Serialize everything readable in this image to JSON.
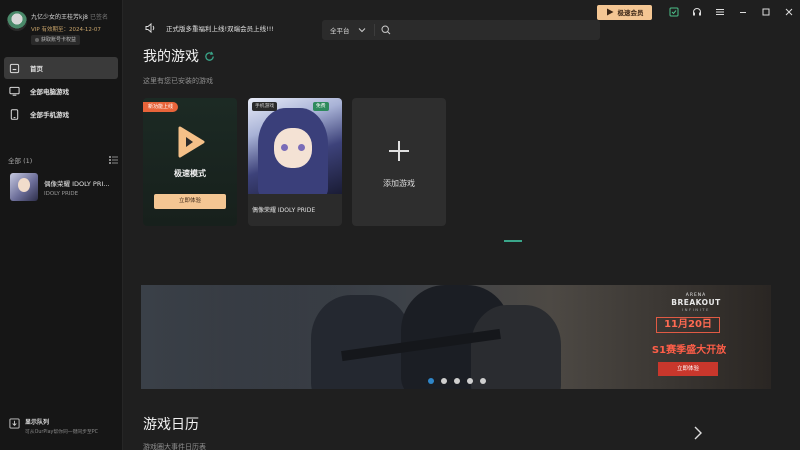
{
  "user": {
    "name": "九亿少女的王桂芳kj8",
    "name_suffix": "已签名",
    "vip_expiry": "VIP 有效期至：2024-12-07",
    "get_vip": "获取账号卡权益"
  },
  "sidebar": {
    "items": [
      {
        "label": "首页",
        "icon": "home-icon",
        "active": true
      },
      {
        "label": "全部电脑游戏",
        "icon": "monitor-icon",
        "active": false
      },
      {
        "label": "全部手机游戏",
        "icon": "phone-icon",
        "active": false
      }
    ],
    "library_header": "全部 (1)",
    "game": {
      "title": "偶像荣耀 IDOLY PRI...",
      "subtitle": "IDOLY PRIDE"
    },
    "queue": {
      "title": "显示队列",
      "subtitle": "可从OurPlay帮你同一键同步至PC"
    }
  },
  "topbar": {
    "announcement": "正式版多重福利上线!双端会员上线!!!",
    "platform": "全平台",
    "search_placeholder": "",
    "vip_button": "极速会员"
  },
  "main": {
    "title": "我的游戏",
    "subtitle": "这里有您已安装的游戏",
    "card_speed": {
      "badge": "新功能上线",
      "label": "极速模式",
      "button": "立即体验"
    },
    "card_game": {
      "tag_mobile": "手机游戏",
      "tag_free": "免费",
      "name": "偶像荣耀 IDOLY PRIDE"
    },
    "card_add": {
      "label": "添加游戏"
    },
    "banner": {
      "logo_top": "ARENA",
      "logo_main": "BREAKOUT",
      "logo_bottom": "INFINITE",
      "date": "11月20日",
      "season": "S1赛季盛大开放",
      "button": "立即体验",
      "slide_count": 5,
      "active_slide": 1
    },
    "calendar_title": "游戏日历",
    "calendar_subtitle": "游戏圈大事件日历表"
  },
  "colors": {
    "accent_gold": "#f4c693",
    "accent_green": "#3aa68a",
    "badge_orange": "#e8643a",
    "banner_red": "#c9372c"
  }
}
